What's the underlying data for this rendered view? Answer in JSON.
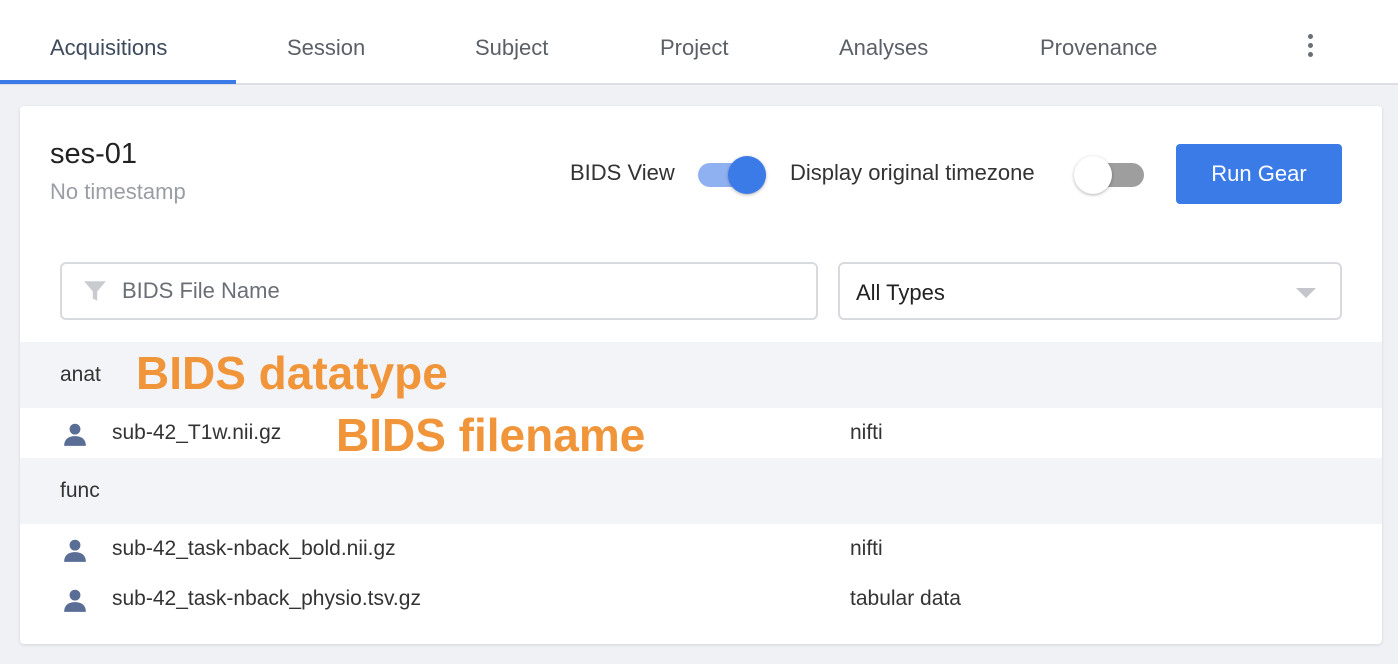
{
  "tabs": [
    {
      "label": "Acquisitions",
      "active": true
    },
    {
      "label": "Session",
      "active": false
    },
    {
      "label": "Subject",
      "active": false
    },
    {
      "label": "Project",
      "active": false
    },
    {
      "label": "Analyses",
      "active": false
    },
    {
      "label": "Provenance",
      "active": false
    }
  ],
  "session": {
    "title": "ses-01",
    "timestamp": "No timestamp"
  },
  "toggles": {
    "bids_view": {
      "label": "BIDS View",
      "on": true
    },
    "timezone": {
      "label": "Display original timezone",
      "on": false
    }
  },
  "run_gear_label": "Run Gear",
  "filter": {
    "placeholder": "BIDS File Name",
    "type_selected": "All Types"
  },
  "groups": [
    {
      "label": "anat",
      "files": [
        {
          "name": "sub-42_T1w.nii.gz",
          "type": "nifti"
        }
      ]
    },
    {
      "label": "func",
      "files": [
        {
          "name": "sub-42_task-nback_bold.nii.gz",
          "type": "nifti"
        },
        {
          "name": "sub-42_task-nback_physio.tsv.gz",
          "type": "tabular data"
        }
      ]
    }
  ],
  "annotations": {
    "datatype": "BIDS datatype",
    "filename": "BIDS filename"
  },
  "colors": {
    "accent": "#3b7be8",
    "annotation": "#f0953a",
    "icon": "#5a6e95"
  }
}
